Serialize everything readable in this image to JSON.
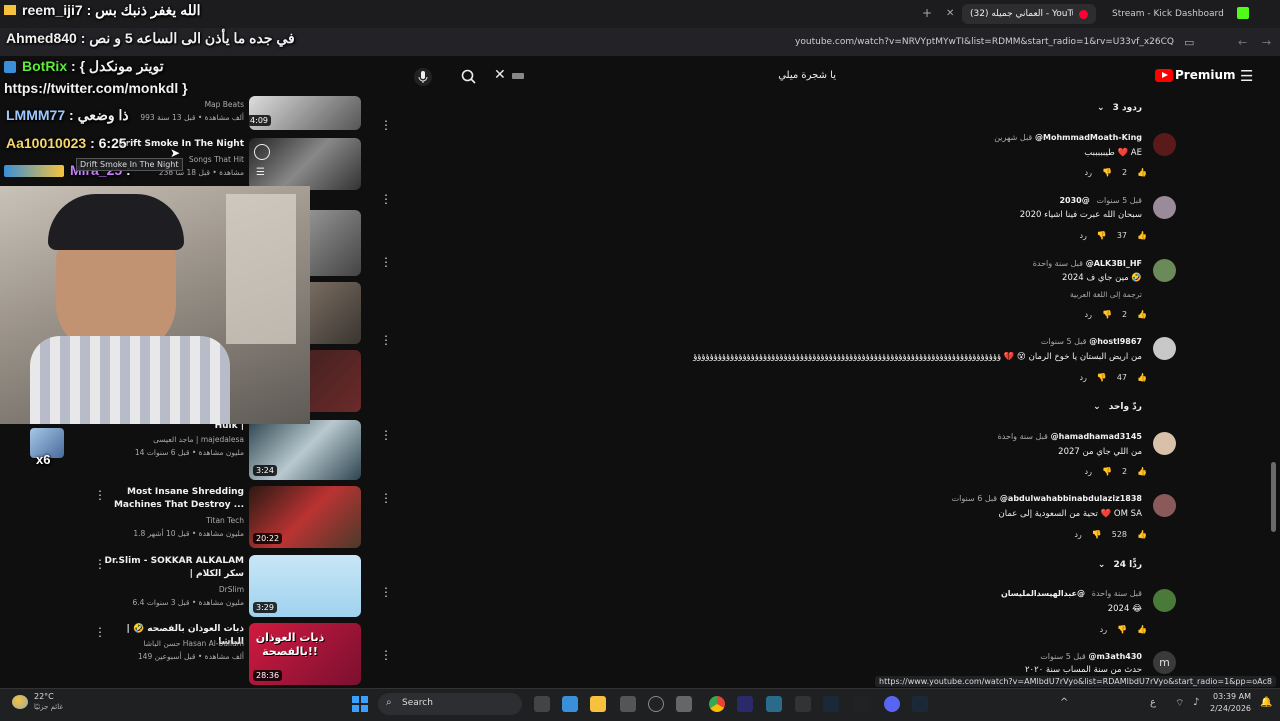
{
  "browser": {
    "tabs": [
      {
        "label": "العماني جميله (32) - YouTube",
        "active": true
      },
      {
        "label": "Stream - Kick Dashboard",
        "active": false
      }
    ],
    "url": "youtube.com/watch?v=NRVYptMYwTI&list=RDMM&start_radio=1&rv=U33vf_x26CQ",
    "status_url": "https://www.youtube.com/watch?v=AMlbdU7rVyo&list=RDAMlbdU7rVyo&start_radio=1&pp=oAc8"
  },
  "youtube": {
    "brand": "Premium",
    "search_value": "يا شجرة ميلي"
  },
  "chat_overlay": [
    {
      "user": "reem_iji7",
      "message": "الله يغفر ذنبك بس"
    },
    {
      "user": "Ahmed840",
      "message": "في جده ما يأذن الى الساعه 5 و نص"
    },
    {
      "user": "BotRix",
      "message": "{ تويتر مونكدل"
    },
    {
      "user": "",
      "message": "https://twitter.com/monkdl }"
    },
    {
      "user": "LMMM77",
      "message": "ذا وضعي"
    },
    {
      "user": "Aa10010023",
      "message": "6:25"
    },
    {
      "user": "Mira_25",
      "message": ""
    }
  ],
  "overlay_misc": {
    "tooltip": "Drift Smoke In The Night",
    "x6": "x6"
  },
  "videos": [
    {
      "title": "",
      "channel": "Map Beats",
      "meta": "993 ألف مشاهدة • قبل 13 سنة",
      "duration": "4:09"
    },
    {
      "title": "Drift Smoke In The Night",
      "channel": "Songs That Hit",
      "meta": "238 مشاهدة • قبل 18 سا",
      "duration": ""
    },
    {
      "title": "Hulk |",
      "channel": "ماجد العيسى | majedalesa",
      "meta": "14 مليون مشاهدة • قبل 6 سنوات",
      "duration": "3:24"
    },
    {
      "title": "Most Insane Shredding Machines That Destroy ...",
      "channel": "Titan Tech",
      "meta": "1.8 مليون مشاهدة • قبل 10 أشهر",
      "duration": "20:22"
    },
    {
      "title": "Dr.Slim - SOKKAR ALKALAM | سكر الكلام",
      "channel": "DrSlim",
      "meta": "6.4 مليون مشاهدة • قبل 3 سنوات",
      "duration": "3:29"
    },
    {
      "title": "ذبات العوذان بالفصحه 🤣 | الباشا",
      "channel": "حسن الباشا Hasan Al-ballam",
      "meta": "149 ألف مشاهدة • قبل أسبوعين",
      "duration": "28:36"
    }
  ],
  "thumb_overlay_text": "ذبات العوذان بالفصحة!!",
  "comments": [
    {
      "replies": "3 ردود"
    },
    {
      "user": "@MohmmadMoath-King",
      "time": "قبل شهرين",
      "text": "طيبببببب ❤️ AE",
      "likes": "2",
      "reply": "رد"
    },
    {
      "user": "@2030",
      "time": "قبل 5 سنوات",
      "text": "2020 سبحان الله عبرت فينا اشياء",
      "likes": "37",
      "reply": "رد"
    },
    {
      "user": "@ALK3BI_HF",
      "time": "قبل سنة واحدة",
      "text": "مين جاي ف 2024 🤣",
      "translate": "ترجمة إلى اللغة العربية",
      "likes": "2",
      "reply": "رد"
    },
    {
      "user": "@hostl9867",
      "time": "قبل 5 سنوات",
      "text": "من اريض البستان يا خوخ الرمان 😵 💔 ‎ؤؤؤؤؤؤؤؤؤؤؤؤؤؤؤؤؤؤؤؤؤؤؤؤؤؤؤؤؤؤؤؤؤؤؤؤؤؤؤؤؤؤؤؤؤؤؤؤؤؤؤؤؤؤؤؤؤؤؤؤؤؤؤؤؤؤؤؤؤؤؤؤؤؤؤ",
      "likes": "47",
      "reply": "رد"
    },
    {
      "replies": "ردّ واحد"
    },
    {
      "user": "@hamadhamad3145",
      "time": "قبل سنة واحدة",
      "text": "من اللي جاي من 2027",
      "likes": "2",
      "reply": "رد"
    },
    {
      "user": "@abdulwahabbinabdulaziz1838",
      "time": "قبل 6 سنوات",
      "text": "تحية من السعودية إلى عمان ❤️ OM SA",
      "likes": "528",
      "reply": "رد"
    },
    {
      "replies": "24 ردًّا"
    },
    {
      "user": "@عبدالهيسدالمليسان",
      "time": "قبل سنة واحدة",
      "text": "2024 😂",
      "likes": "",
      "reply": "رد"
    },
    {
      "user": "@m3ath430",
      "time": "قبل 5 سنوات",
      "text": "حدث من سنة المساب سنة ٢٠٢٠",
      "likes": "",
      "reply": ""
    }
  ],
  "taskbar": {
    "weather_temp": "22°C",
    "weather_desc": "غائم جزئيًا",
    "search_label": "Search",
    "time": "03:39 AM",
    "date": "2/24/2026"
  }
}
